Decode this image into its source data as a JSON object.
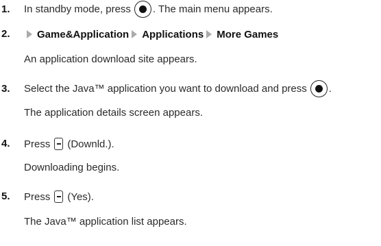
{
  "steps": [
    {
      "number": "1.",
      "text_before_key": "In standby mode, press",
      "key_icon": "center-select-key",
      "text_after_key": ". The main menu appears."
    },
    {
      "number": "2.",
      "path": [
        "Game&Application",
        "Applications",
        "More Games"
      ],
      "description": "An application download site appears."
    },
    {
      "number": "3.",
      "text_before_key": "Select the Java™ application you want to download and press",
      "key_icon": "center-select-key",
      "text_after_key": ".",
      "description": "The application details screen appears."
    },
    {
      "number": "4.",
      "text_before_key": "Press",
      "key_icon": "left-soft-key",
      "text_after_key": "(Downld.).",
      "description": "Downloading begins."
    },
    {
      "number": "5.",
      "text_before_key": "Press",
      "key_icon": "left-soft-key",
      "text_after_key": "(Yes).",
      "description": "The Java™ application list appears."
    }
  ]
}
